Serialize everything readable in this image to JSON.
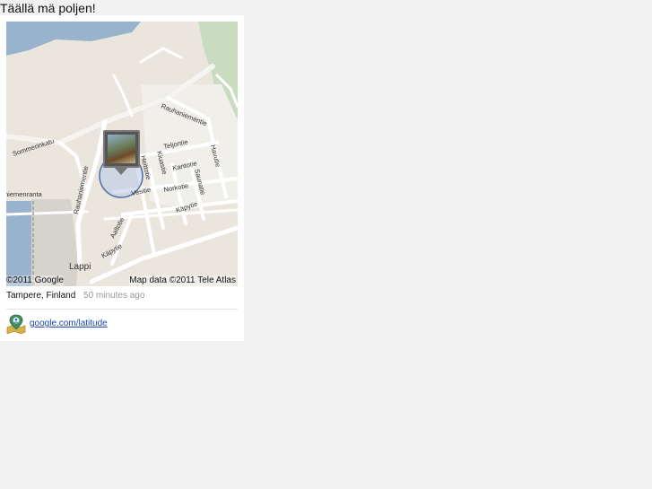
{
  "heading": "Täällä mä poljen!",
  "map": {
    "streets": {
      "rauhaniementie_ne": "Rauhaniementie",
      "sommerinkatu": "Sommerinkatu",
      "rauhaniementie_w": "Rauhaniementie",
      "rauhaniemenranta": "niemenranta",
      "teljontie": "Teljontie",
      "kiuastie": "Kiuastie",
      "kantotie": "Kantotie",
      "saunatie": "Saunatie",
      "havutie": "Havutie",
      "heittotie": "Heittotie",
      "vesitie": "Vesitie",
      "norkotie": "Norkotie",
      "aaltotie": "Aaltotie",
      "kapytie_s": "Käpytie",
      "kapytie_e": "Käpytie"
    },
    "place": "Lappi",
    "copyright": "©2011 Google",
    "map_data": "Map data ©2011 Tele Atlas"
  },
  "location": {
    "name": "Tampere, Finland",
    "time_ago": "50 minutes ago"
  },
  "footer": {
    "icon": "latitude-icon",
    "link": "google.com/latitude"
  }
}
